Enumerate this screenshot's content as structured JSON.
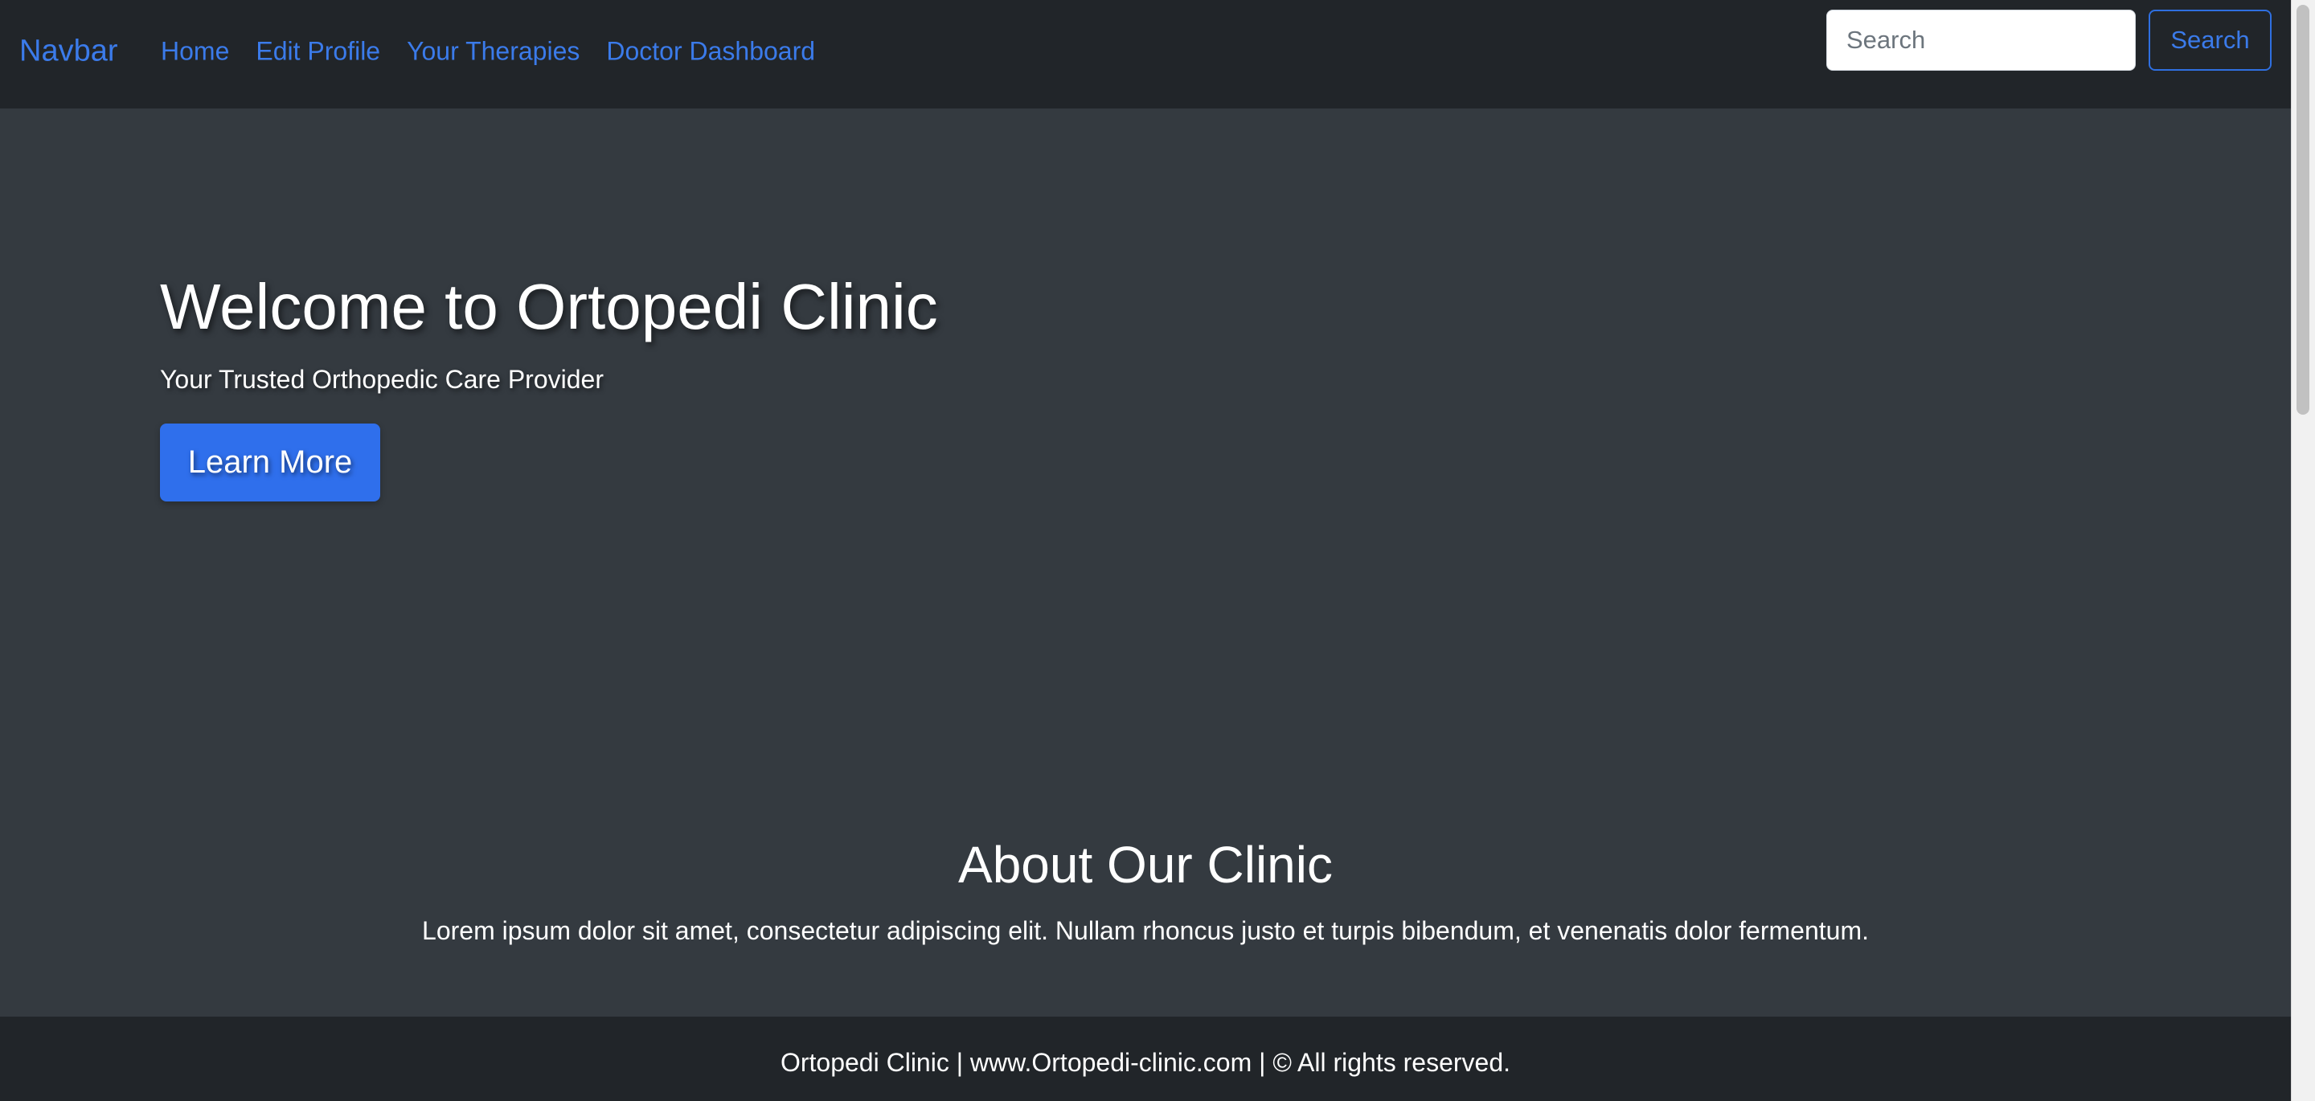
{
  "navbar": {
    "brand": "Navbar",
    "links": [
      "Home",
      "Edit Profile",
      "Your Therapies",
      "Doctor Dashboard"
    ],
    "search": {
      "placeholder": "Search",
      "value": "",
      "button_label": "Search"
    }
  },
  "hero": {
    "title": "Welcome to Ortopedi Clinic",
    "subtitle": "Your Trusted Orthopedic Care Provider",
    "button_label": "Learn More"
  },
  "about": {
    "title": "About Our Clinic",
    "text": "Lorem ipsum dolor sit amet, consectetur adipiscing elit. Nullam rhoncus justo et turpis bibendum, et venenatis dolor fermentum."
  },
  "footer": {
    "text": "Ortopedi Clinic | www.Ortopedi-clinic.com | © All rights reserved."
  },
  "colors": {
    "navbar_bg": "#212529",
    "page_bg": "#343a40",
    "link": "#3b7bea",
    "primary_button": "#2f6fec"
  }
}
